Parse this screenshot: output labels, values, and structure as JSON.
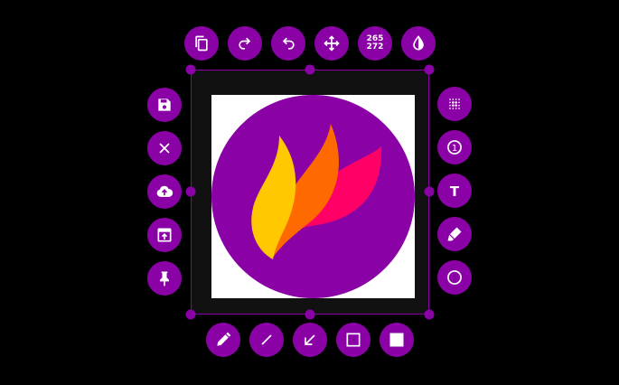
{
  "colors": {
    "accent": "#8a02a6",
    "background": "#000000",
    "selection_fill": "#111111",
    "logo_circle": "#8a02a6",
    "flame_yellow": "#ffc800",
    "flame_orange": "#ff6a00",
    "flame_pink": "#ff0066"
  },
  "selection_size": {
    "width": "265",
    "height": "272"
  },
  "toolbar_top": [
    {
      "icon": "copy-icon"
    },
    {
      "icon": "redo-icon"
    },
    {
      "icon": "undo-icon"
    },
    {
      "icon": "move-icon"
    },
    {
      "icon": "selection-size"
    },
    {
      "icon": "color-picker-icon"
    }
  ],
  "toolbar_left": [
    {
      "icon": "save-icon"
    },
    {
      "icon": "close-icon"
    },
    {
      "icon": "upload-icon"
    },
    {
      "icon": "open-with-app-icon"
    },
    {
      "icon": "pin-icon"
    }
  ],
  "toolbar_right": [
    {
      "icon": "pixelate-icon"
    },
    {
      "icon": "counter-icon"
    },
    {
      "icon": "text-icon"
    },
    {
      "icon": "marker-icon"
    },
    {
      "icon": "circle-icon"
    }
  ],
  "toolbar_bottom": [
    {
      "icon": "pencil-icon"
    },
    {
      "icon": "line-icon"
    },
    {
      "icon": "arrow-icon"
    },
    {
      "icon": "rectangle-icon"
    },
    {
      "icon": "filled-rectangle-icon"
    }
  ],
  "counter_value": "1",
  "text_tool_glyph": "T"
}
